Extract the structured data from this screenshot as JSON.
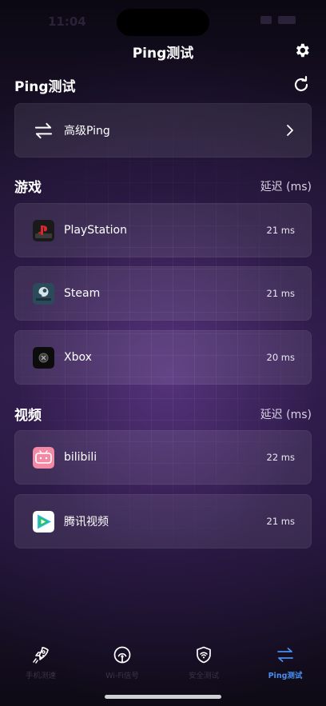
{
  "status_bar": {
    "time": "11:04"
  },
  "nav": {
    "title": "Ping测试",
    "settings_icon": "gear-icon"
  },
  "ping_section": {
    "title": "Ping测试",
    "refresh_icon": "refresh-icon",
    "advanced": {
      "label": "高级Ping",
      "icon": "arrows-swap-icon"
    }
  },
  "games_section": {
    "title": "游戏",
    "unit": "延迟 (ms)",
    "items": [
      {
        "label": "PlayStation",
        "latency": "21 ms",
        "icon": "playstation-icon"
      },
      {
        "label": "Steam",
        "latency": "21 ms",
        "icon": "steam-icon"
      },
      {
        "label": "Xbox",
        "latency": "20 ms",
        "icon": "xbox-icon"
      }
    ]
  },
  "video_section": {
    "title": "视频",
    "unit": "延迟 (ms)",
    "items": [
      {
        "label": "bilibili",
        "latency": "22 ms",
        "icon": "bilibili-icon"
      },
      {
        "label": "腾讯视频",
        "latency": "21 ms",
        "icon": "tencent-video-icon"
      }
    ]
  },
  "tab_bar": {
    "tabs": [
      {
        "label": "手机测速",
        "icon": "rocket-icon",
        "active": false
      },
      {
        "label": "Wi-Fi信号",
        "icon": "wifi-signal-icon",
        "active": false
      },
      {
        "label": "安全测试",
        "icon": "shield-wifi-icon",
        "active": false
      },
      {
        "label": "Ping测试",
        "icon": "arrows-swap-icon",
        "active": true
      }
    ]
  },
  "colors": {
    "accent": "#4a8ef0",
    "background_top": "#0b0812",
    "background_mid": "#2c1c44",
    "card": "#ffffff16"
  }
}
